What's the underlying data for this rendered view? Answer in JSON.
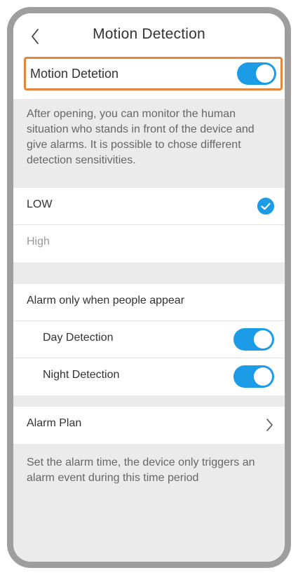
{
  "header": {
    "title": "Motion Detection",
    "back_icon": "chevron-left-icon"
  },
  "motion_detection": {
    "label": "Motion Detetion",
    "enabled": true,
    "description": "After opening, you can monitor the human situation who stands in front of the device and give alarms. It is possible to chose different detection sensitivities."
  },
  "sensitivity": {
    "options": [
      {
        "label": "LOW",
        "selected": true
      },
      {
        "label": "High",
        "selected": false
      }
    ],
    "check_icon": "check-circle-icon"
  },
  "alarm_people": {
    "label": "Alarm only when people appear",
    "day": {
      "label": "Day Detection",
      "enabled": true
    },
    "night": {
      "label": "Night Detection",
      "enabled": true
    }
  },
  "alarm_plan": {
    "label": "Alarm Plan",
    "chevron_icon": "chevron-right-icon",
    "description": "Set the alarm time, the device only triggers an alarm event during this time period"
  },
  "colors": {
    "accent": "#1c9be6",
    "highlight_border": "#e8853c",
    "background": "#ebebeb",
    "frame": "#9e9e9e"
  }
}
